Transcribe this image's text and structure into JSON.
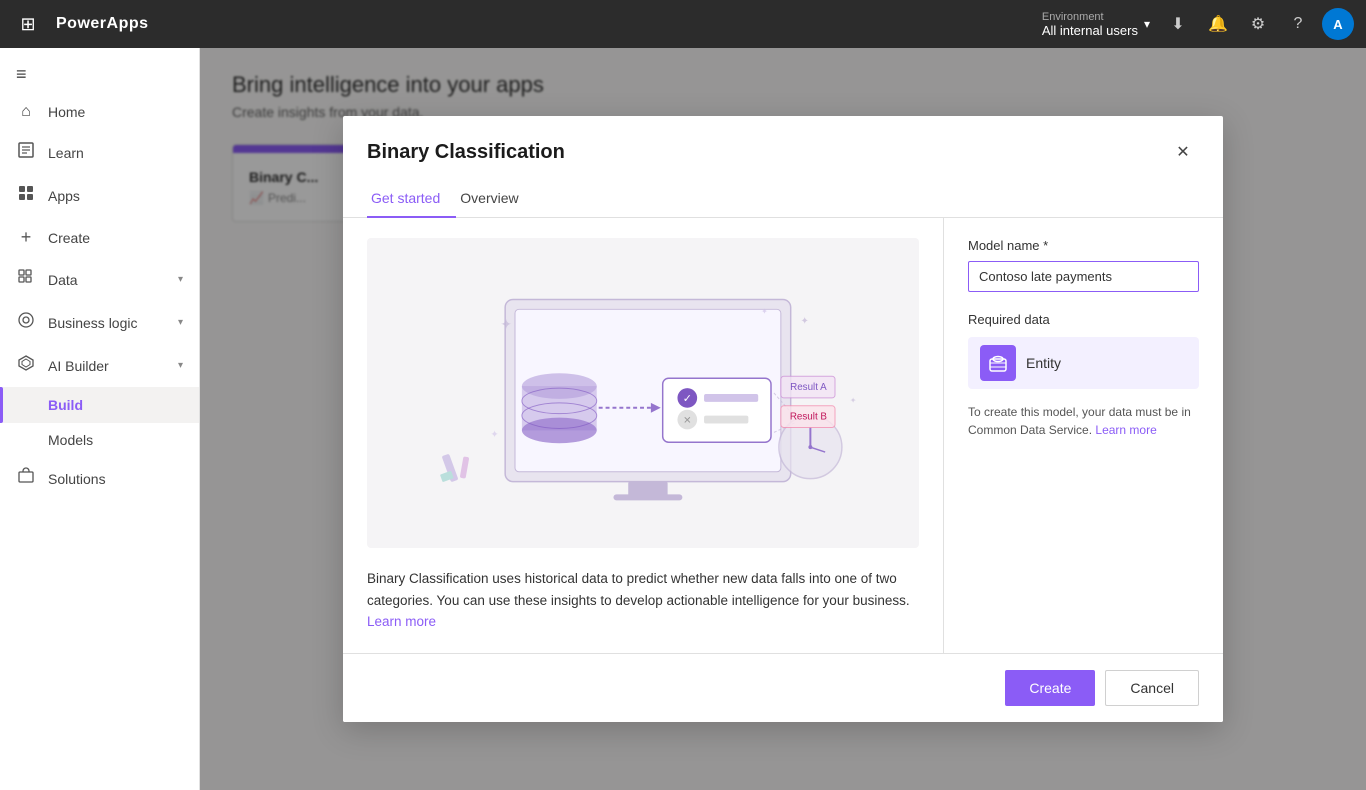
{
  "topbar": {
    "app_name": "PowerApps",
    "env_label": "Environment",
    "env_value": "All internal users",
    "waffle_icon": "⊞"
  },
  "sidebar": {
    "collapse_icon": "≡",
    "items": [
      {
        "id": "home",
        "label": "Home",
        "icon": "⌂",
        "has_chevron": false
      },
      {
        "id": "learn",
        "label": "Learn",
        "icon": "□",
        "has_chevron": false
      },
      {
        "id": "apps",
        "label": "Apps",
        "icon": "⊞",
        "has_chevron": false
      },
      {
        "id": "create",
        "label": "Create",
        "icon": "+",
        "has_chevron": false
      },
      {
        "id": "data",
        "label": "Data",
        "icon": "▦",
        "has_chevron": true
      },
      {
        "id": "business-logic",
        "label": "Business logic",
        "icon": "◎",
        "has_chevron": true
      },
      {
        "id": "ai-builder",
        "label": "AI Builder",
        "icon": "✦",
        "has_chevron": true
      },
      {
        "id": "build",
        "label": "Build",
        "icon": "",
        "has_chevron": false,
        "active": true
      },
      {
        "id": "models",
        "label": "Models",
        "icon": "",
        "has_chevron": false,
        "sub": true
      },
      {
        "id": "solutions",
        "label": "Solutions",
        "icon": "◫",
        "has_chevron": false
      }
    ]
  },
  "background": {
    "title": "Bring intelligence into your apps",
    "subtitle": "Create insights from your data.",
    "card": {
      "title": "Binary C...",
      "sub_label": "Predi..."
    }
  },
  "modal": {
    "title": "Binary Classification",
    "close_icon": "✕",
    "tabs": [
      {
        "id": "get-started",
        "label": "Get started",
        "active": true
      },
      {
        "id": "overview",
        "label": "Overview",
        "active": false
      }
    ],
    "model_name_label": "Model name *",
    "model_name_value": "Contoso late payments",
    "required_data_label": "Required data",
    "entity_label": "Entity",
    "cds_note": "To create this model, your data must be in Common Data Service.",
    "cds_link_label": "Learn more",
    "description": "Binary Classification uses historical data to predict whether new data falls into one of two categories. You can use these insights to develop actionable intelligence for your business.",
    "desc_link_label": "Learn more",
    "create_button": "Create",
    "cancel_button": "Cancel"
  }
}
